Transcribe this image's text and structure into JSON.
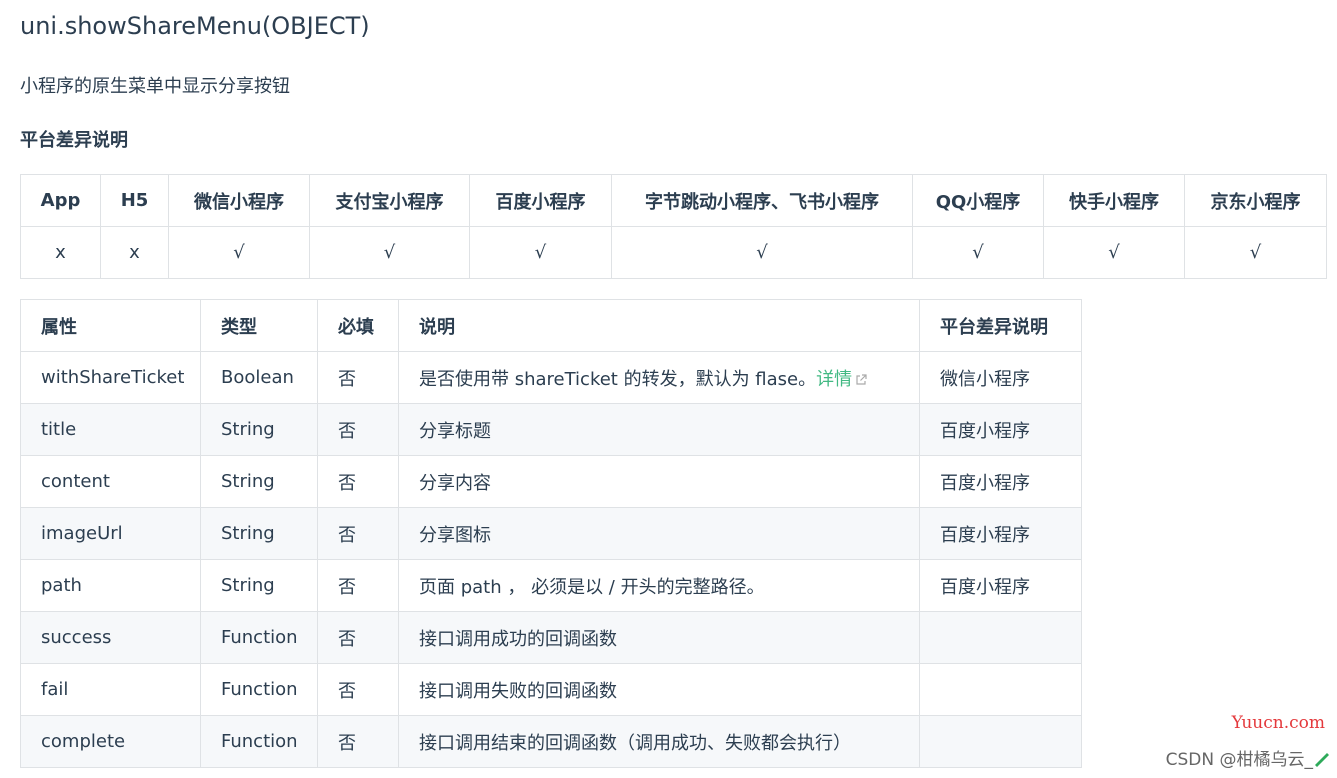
{
  "title": "uni.showShareMenu(OBJECT)",
  "description": "小程序的原生菜单中显示分享按钮",
  "platform_heading": "平台差异说明",
  "platform_table": {
    "headers": [
      "App",
      "H5",
      "微信小程序",
      "支付宝小程序",
      "百度小程序",
      "字节跳动小程序、飞书小程序",
      "QQ小程序",
      "快手小程序",
      "京东小程序"
    ],
    "values": [
      "x",
      "x",
      "√",
      "√",
      "√",
      "√",
      "√",
      "√",
      "√"
    ]
  },
  "params_table": {
    "headers": [
      "属性",
      "类型",
      "必填",
      "说明",
      "平台差异说明"
    ],
    "rows": [
      {
        "name": "withShareTicket",
        "type": "Boolean",
        "required": "否",
        "desc": "是否使用带 shareTicket 的转发，默认为 flase。",
        "link": "详情",
        "platform": "微信小程序"
      },
      {
        "name": "title",
        "type": "String",
        "required": "否",
        "desc": "分享标题",
        "platform": "百度小程序"
      },
      {
        "name": "content",
        "type": "String",
        "required": "否",
        "desc": "分享内容",
        "platform": "百度小程序"
      },
      {
        "name": "imageUrl",
        "type": "String",
        "required": "否",
        "desc": "分享图标",
        "platform": "百度小程序"
      },
      {
        "name": "path",
        "type": "String",
        "required": "否",
        "desc": "页面 path ， 必须是以 / 开头的完整路径。",
        "platform": "百度小程序"
      },
      {
        "name": "success",
        "type": "Function",
        "required": "否",
        "desc": "接口调用成功的回调函数",
        "platform": ""
      },
      {
        "name": "fail",
        "type": "Function",
        "required": "否",
        "desc": "接口调用失败的回调函数",
        "platform": ""
      },
      {
        "name": "complete",
        "type": "Function",
        "required": "否",
        "desc": "接口调用结束的回调函数（调用成功、失败都会执行）",
        "platform": ""
      }
    ]
  },
  "watermark": {
    "site": "Yuucn.com",
    "author": "CSDN @柑橘乌云_"
  },
  "colors": {
    "text": "#2c3e50",
    "link": "#42b983",
    "border": "#dfe2e5",
    "stripe": "#f6f8fa",
    "watermark_site": "#e4393c"
  }
}
